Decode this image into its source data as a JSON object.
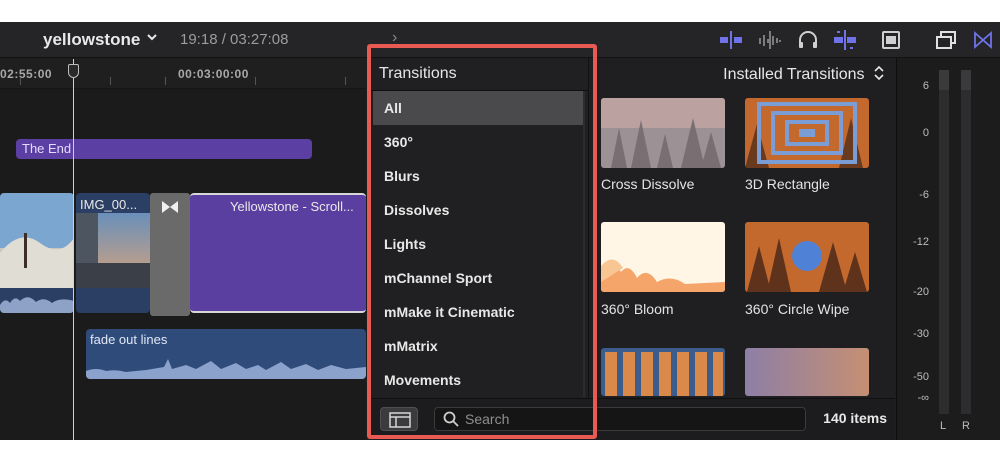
{
  "toolbar": {
    "project_name": "yellowstone",
    "timecode": "19:18 / 03:27:08",
    "nav_arrow": "›",
    "accent_color": "#6f72e8"
  },
  "timeline": {
    "ruler_labels": [
      "02:55:00",
      "00:03:00:00"
    ],
    "title_clip": "The End",
    "clips": [
      {
        "label": ""
      },
      {
        "label": "IMG_00..."
      },
      {
        "label": "Yellowstone - Scroll..."
      }
    ],
    "audio_clip": "fade out lines"
  },
  "sidebar": {
    "title": "Transitions",
    "items": [
      {
        "label": "All",
        "selected": true
      },
      {
        "label": "360°",
        "selected": false
      },
      {
        "label": "Blurs",
        "selected": false
      },
      {
        "label": "Dissolves",
        "selected": false
      },
      {
        "label": "Lights",
        "selected": false
      },
      {
        "label": "mChannel Sport",
        "selected": false
      },
      {
        "label": "mMake it Cinematic",
        "selected": false
      },
      {
        "label": "mMatrix",
        "selected": false
      },
      {
        "label": "Movements",
        "selected": false
      }
    ]
  },
  "browser": {
    "header": "Installed Transitions",
    "thumbnails": [
      {
        "label": "Cross Dissolve"
      },
      {
        "label": "3D Rectangle"
      },
      {
        "label": "360° Bloom"
      },
      {
        "label": "360° Circle Wipe"
      },
      {
        "label": ""
      },
      {
        "label": ""
      }
    ]
  },
  "bottom": {
    "search_placeholder": "Search",
    "items_count": "140 items"
  },
  "meters": {
    "scale": [
      "6",
      "0",
      "-6",
      "-12",
      "-20",
      "-30",
      "-50",
      "-∞"
    ],
    "channels": [
      "L",
      "R"
    ]
  },
  "highlight_color": "#e85a52"
}
